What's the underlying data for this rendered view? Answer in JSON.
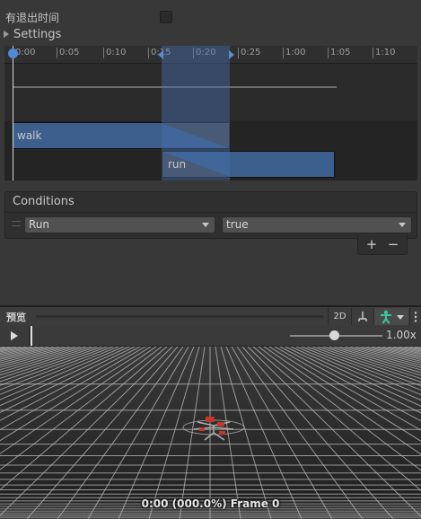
{
  "state": {
    "exit_time_label": "有退出时间",
    "exit_time_checked": false,
    "settings_label": "Settings"
  },
  "timeline": {
    "ticks": [
      "0:00",
      "0:05",
      "0:10",
      "0:15",
      "0:20",
      "0:25",
      "1:00",
      "1:05",
      "1:10"
    ],
    "clip_from": "walk",
    "clip_to": "run"
  },
  "conditions": {
    "title": "Conditions",
    "items": [
      {
        "parameter": "Run",
        "value": "true"
      }
    ],
    "add_label": "+",
    "remove_label": "−"
  },
  "preview": {
    "title": "预览",
    "mode_2d_label": "2D",
    "speed": "1.00x",
    "frame_readout": "0:00 (000.0%) Frame 0"
  },
  "icons": {
    "play": "play-icon",
    "pivot": "pivot-icon",
    "avatar": "avatar-icon",
    "more": "more-icon",
    "settings_foldout": "triangle-right-icon",
    "dropdown": "chevron-down-icon"
  },
  "colors": {
    "accent": "#4e8ad8",
    "clip": "#3d5f8e",
    "avatar_icon": "#35c7a0"
  }
}
